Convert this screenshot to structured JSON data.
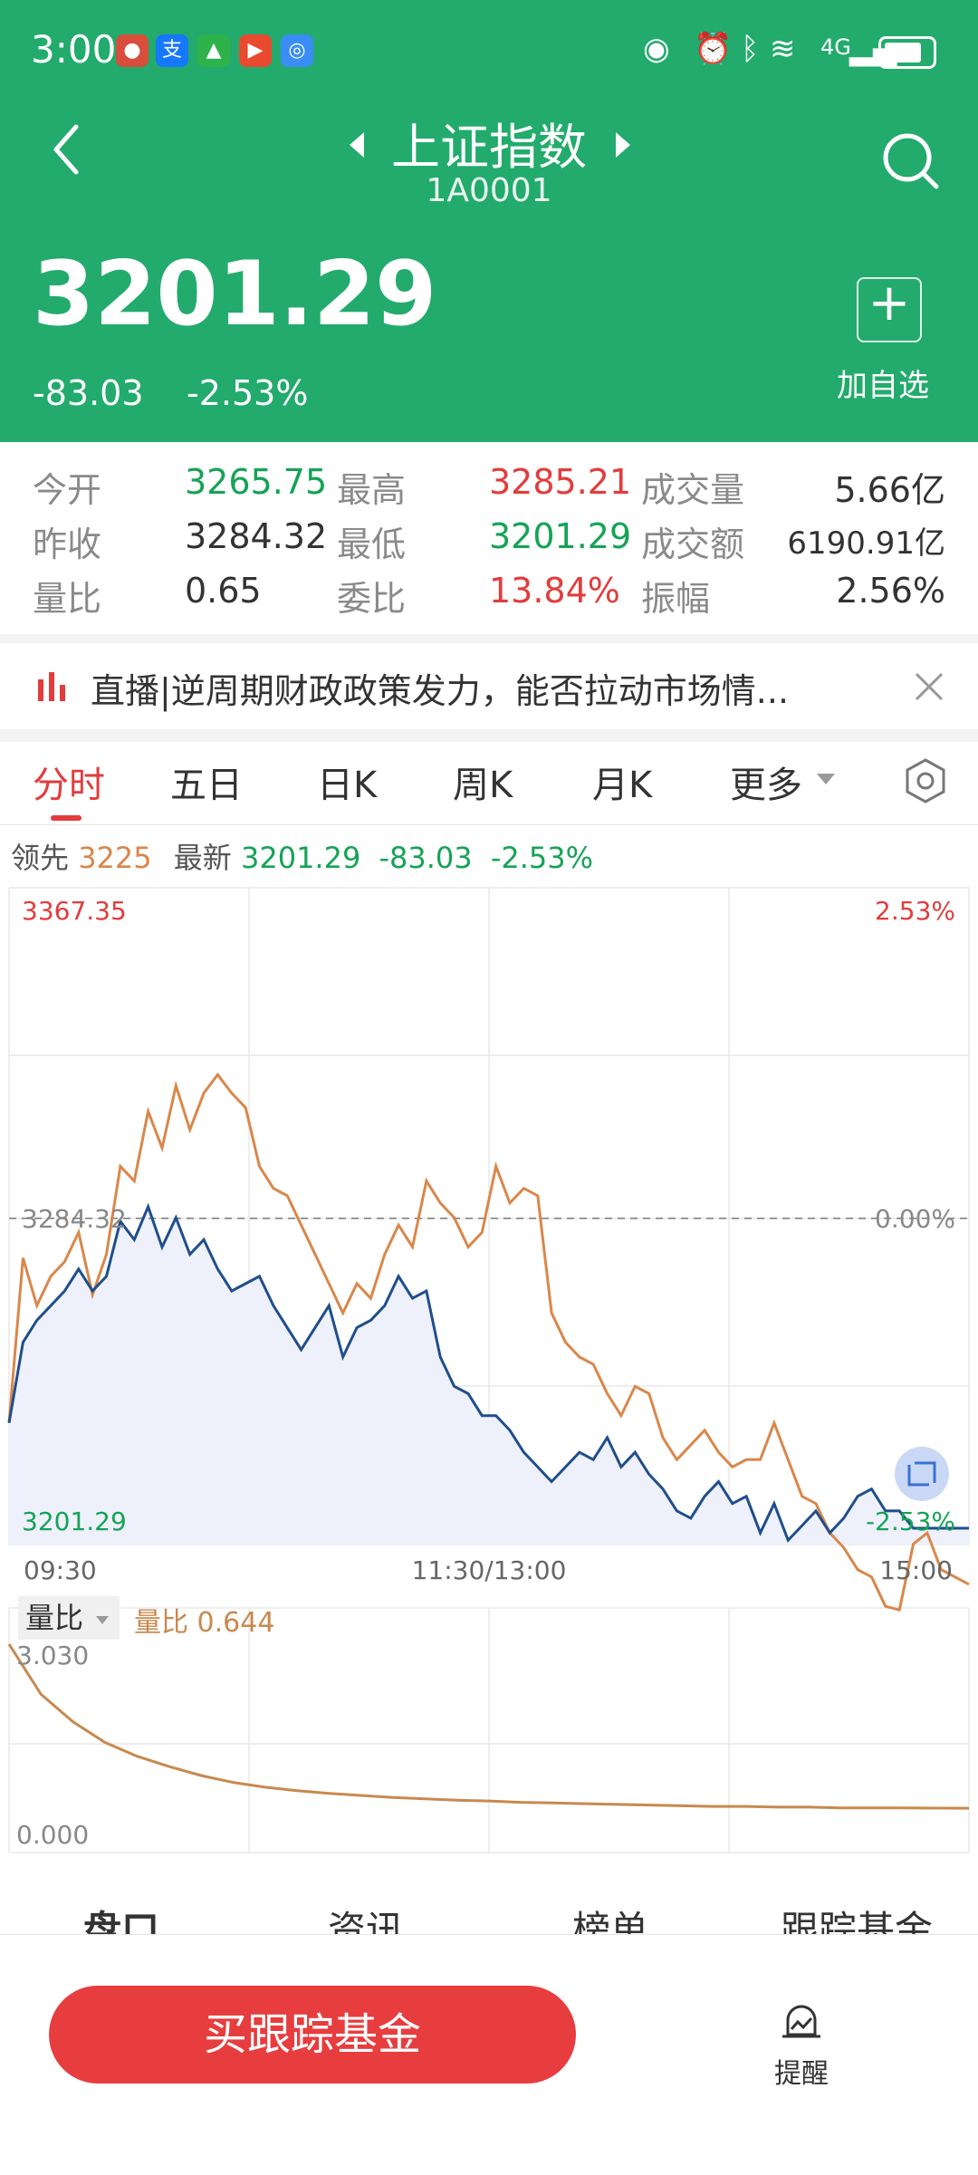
{
  "status_bar": {
    "time": "3:00",
    "network": "4G"
  },
  "header": {
    "title": "上证指数",
    "code": "1A0001",
    "price": "3201.29",
    "change": "-83.03",
    "change_pct": "-2.53%",
    "add_label": "加自选"
  },
  "quote": {
    "row1": [
      {
        "label": "今开",
        "value": "3265.75"
      },
      {
        "label": "最高",
        "value": "3285.21"
      },
      {
        "label": "成交量",
        "value": "5.66亿"
      }
    ],
    "row2": [
      {
        "label": "昨收",
        "value": "3284.32"
      },
      {
        "label": "最低",
        "value": "3201.29"
      },
      {
        "label": "成交额",
        "value": "6190.91亿"
      }
    ],
    "row3": [
      {
        "label": "量比",
        "value": "0.65"
      },
      {
        "label": "委比",
        "value": "13.84%"
      },
      {
        "label": "振幅",
        "value": "2.56%"
      }
    ]
  },
  "news": {
    "text": "直播|逆周期财政政策发力，能否拉动市场情..."
  },
  "tabs": [
    "分时",
    "五日",
    "日K",
    "周K",
    "月K",
    "更多"
  ],
  "legend": {
    "lead_label": "领先",
    "lead_value": "3225",
    "latest_label": "最新",
    "latest_value": "3201.29",
    "change": "-83.03",
    "change_pct": "-2.53%"
  },
  "chart_labels": {
    "high": "3367.35",
    "high_pct": "2.53%",
    "mid": "3284.32",
    "mid_pct": "0.00%",
    "low": "3201.29",
    "low_pct": "-2.53%",
    "t_start": "09:30",
    "t_mid": "11:30/13:00",
    "t_end": "15:00"
  },
  "volume": {
    "label": "量比",
    "value_label": "量比 0.644",
    "max": "3.030",
    "min": "0.000"
  },
  "bottom_tabs": [
    "盘口",
    "资讯",
    "榜单",
    "跟踪基金"
  ],
  "bottom": {
    "buy_label": "买跟踪基金",
    "remind_label": "提醒"
  },
  "colors": {
    "brand": "#22ab6c",
    "up": "#e23c3c",
    "down": "#15a356",
    "lead_line": "#d9874a",
    "price_line": "#1f4e8c",
    "fill": "#eef1fb"
  },
  "chart_data": {
    "type": "line",
    "x_range": [
      "09:30",
      "15:00"
    ],
    "ylim": [
      3201.29,
      3367.35
    ],
    "prev_close": 3284.32,
    "series": [
      {
        "name": "领先",
        "values": [
          3230,
          3275,
          3262,
          3270,
          3274,
          3282,
          3265,
          3276,
          3300,
          3296,
          3315,
          3305,
          3322,
          3310,
          3320,
          3325,
          3320,
          3316,
          3300,
          3294,
          3292,
          3284,
          3276,
          3268,
          3260,
          3268,
          3264,
          3276,
          3284,
          3278,
          3296,
          3290,
          3286,
          3278,
          3282,
          3300,
          3290,
          3294,
          3292,
          3260,
          3252,
          3248,
          3246,
          3238,
          3232,
          3240,
          3238,
          3226,
          3220,
          3224,
          3228,
          3222,
          3218,
          3220,
          3220,
          3230,
          3220,
          3210,
          3208,
          3200,
          3196,
          3190,
          3188,
          3180,
          3179,
          3197,
          3200,
          3190,
          3188,
          3186
        ]
      },
      {
        "name": "最新",
        "values": [
          3230,
          3252,
          3258,
          3262,
          3266,
          3272,
          3266,
          3270,
          3285,
          3280,
          3289,
          3278,
          3286,
          3276,
          3280,
          3272,
          3266,
          3268,
          3270,
          3262,
          3256,
          3250,
          3256,
          3262,
          3248,
          3256,
          3258,
          3262,
          3270,
          3264,
          3266,
          3248,
          3240,
          3238,
          3232,
          3232,
          3228,
          3222,
          3218,
          3214,
          3218,
          3222,
          3220,
          3226,
          3218,
          3222,
          3216,
          3212,
          3206,
          3204,
          3210,
          3214,
          3208,
          3210,
          3200,
          3208,
          3198,
          3202,
          3206,
          3200,
          3204,
          3210,
          3212,
          3206,
          3206,
          3201.29,
          3201.29,
          3201.29,
          3201.29,
          3201.29
        ]
      }
    ],
    "volume_ratio": {
      "ylim": [
        0,
        3.03
      ],
      "values": [
        3.03,
        2.3,
        1.9,
        1.6,
        1.4,
        1.25,
        1.12,
        1.02,
        0.95,
        0.9,
        0.86,
        0.83,
        0.8,
        0.78,
        0.76,
        0.75,
        0.73,
        0.72,
        0.71,
        0.7,
        0.69,
        0.68,
        0.67,
        0.67,
        0.66,
        0.66,
        0.65,
        0.65,
        0.65,
        0.645,
        0.644
      ]
    }
  }
}
